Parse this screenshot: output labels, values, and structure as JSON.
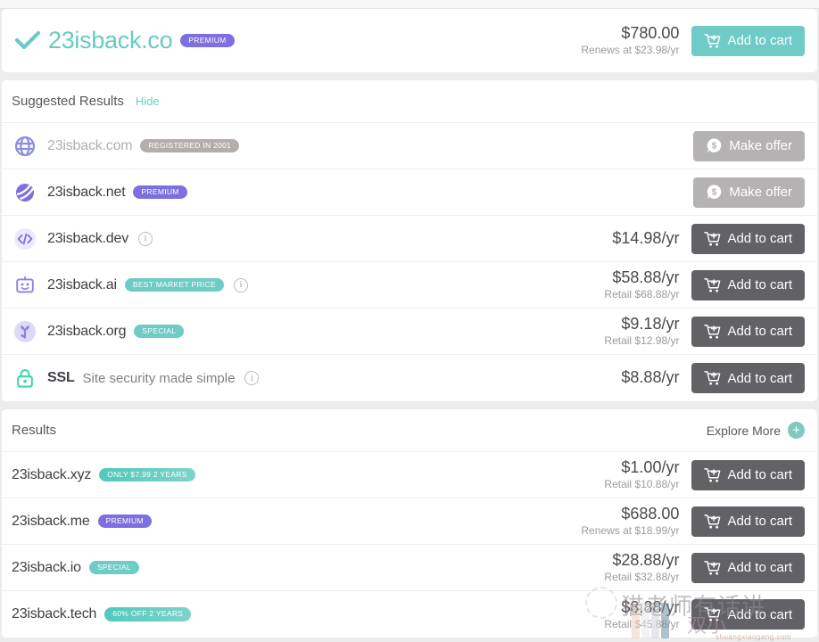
{
  "colors": {
    "teal": "#6ecbc5",
    "purple": "#7d6fe0",
    "dark_button": "#616166",
    "grey_button": "#b4b2b3",
    "badge_grey": "#b3aeab",
    "text": "#3f3f44",
    "muted_text": "#9b9b9f"
  },
  "featured": {
    "check_icon": "check-icon",
    "domain": "23isback.co",
    "badge": {
      "label": "PREMIUM",
      "style": "purple"
    },
    "price": "$780.00",
    "price_sub": "Renews at $23.98/yr",
    "button": {
      "label": "Add to cart",
      "icon": "cart-plus-icon",
      "style": "teal"
    }
  },
  "suggested": {
    "title": "Suggested Results",
    "hide_label": "Hide",
    "rows": [
      {
        "domain": "23isback.com",
        "icon": "globe-icon",
        "muted": true,
        "badge": {
          "label": "REGISTERED IN 2001",
          "style": "grey"
        },
        "info": false,
        "price": "",
        "price_sub": "",
        "button": {
          "label": "Make offer",
          "icon": "offer-bubble-icon",
          "style": "grey"
        }
      },
      {
        "domain": "23isback.net",
        "icon": "sphere-icon",
        "muted": false,
        "badge": {
          "label": "PREMIUM",
          "style": "purple"
        },
        "info": false,
        "price": "",
        "price_sub": "",
        "button": {
          "label": "Make offer",
          "icon": "offer-bubble-icon",
          "style": "grey"
        }
      },
      {
        "domain": "23isback.dev",
        "icon": "code-icon",
        "muted": false,
        "badge": null,
        "info": true,
        "price": "$14.98/yr",
        "price_sub": "",
        "button": {
          "label": "Add to cart",
          "icon": "cart-plus-icon",
          "style": "dark"
        }
      },
      {
        "domain": "23isback.ai",
        "icon": "robot-icon",
        "muted": false,
        "badge": {
          "label": "BEST MARKET PRICE",
          "style": "teal"
        },
        "info": true,
        "price": "$58.88/yr",
        "price_sub": "Retail $68.88/yr",
        "button": {
          "label": "Add to cart",
          "icon": "cart-plus-icon",
          "style": "dark"
        }
      },
      {
        "domain": "23isback.org",
        "icon": "sprout-icon",
        "muted": false,
        "badge": {
          "label": "SPECIAL",
          "style": "teal"
        },
        "info": false,
        "price": "$9.18/yr",
        "price_sub": "Retail $12.98/yr",
        "button": {
          "label": "Add to cart",
          "icon": "cart-plus-icon",
          "style": "dark"
        }
      },
      {
        "domain": "SSL",
        "icon": "lock-icon",
        "muted": false,
        "bold_name": true,
        "subtitle": "Site security made simple",
        "badge": null,
        "info": true,
        "price": "$8.88/yr",
        "price_sub": "",
        "button": {
          "label": "Add to cart",
          "icon": "cart-plus-icon",
          "style": "dark"
        }
      }
    ]
  },
  "results": {
    "title": "Results",
    "explore_more_label": "Explore More",
    "explore_more_icon": "plus-circle-icon",
    "rows": [
      {
        "domain": "23isback.xyz",
        "badge": {
          "label": "ONLY $7.99 2 YEARS",
          "style": "teal2"
        },
        "price": "$1.00/yr",
        "price_sub": "Retail $10.88/yr",
        "button": {
          "label": "Add to cart",
          "icon": "cart-plus-icon",
          "style": "dark"
        }
      },
      {
        "domain": "23isback.me",
        "badge": {
          "label": "PREMIUM",
          "style": "purple"
        },
        "price": "$688.00",
        "price_sub": "Renews at $18.99/yr",
        "button": {
          "label": "Add to cart",
          "icon": "cart-plus-icon",
          "style": "dark"
        }
      },
      {
        "domain": "23isback.io",
        "badge": {
          "label": "SPECIAL",
          "style": "teal"
        },
        "price": "$28.88/yr",
        "price_sub": "Retail $32.88/yr",
        "button": {
          "label": "Add to cart",
          "icon": "cart-plus-icon",
          "style": "dark"
        }
      },
      {
        "domain": "23isback.tech",
        "badge": {
          "label": "60% OFF 2 YEARS",
          "style": "teal2"
        },
        "price": "$8.88/yr",
        "price_sub": "Retail $45.88/yr",
        "button": {
          "label": "Add to cart",
          "icon": "cart-plus-icon",
          "style": "dark"
        }
      }
    ]
  },
  "watermark": {
    "text": "猫老师有话讲",
    "text2": "双小",
    "site": "shuangxiaogang.com"
  }
}
